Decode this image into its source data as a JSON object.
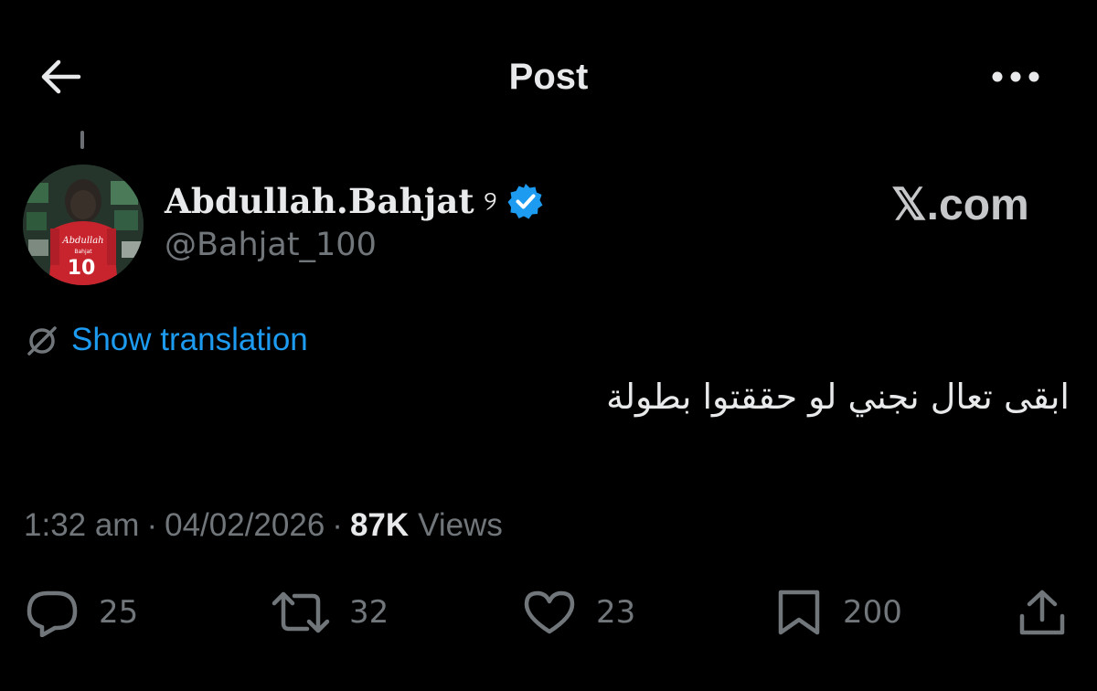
{
  "header": {
    "title": "Post",
    "back_icon": "arrow-left-icon",
    "more_icon": "more-horizontal-icon"
  },
  "author": {
    "display_name": "Abdullah.Bahjat",
    "name_emoji": "୨",
    "handle": "@Bahjat_100",
    "verified": true,
    "verified_color": "#1d9bf0",
    "avatar_jersey_name": "Abdullah",
    "avatar_jersey_sub": "Bahjat",
    "avatar_jersey_number": "10"
  },
  "watermark": {
    "text": "𝕏.com"
  },
  "translation": {
    "label": "Show translation",
    "color": "#1d9bf0"
  },
  "tweet": {
    "text": "ابقى تعال نجني لو حققتوا بطولة",
    "time": "1:32 am",
    "date": "04/02/2026",
    "separator": "·",
    "views_count": "87K",
    "views_label": "Views"
  },
  "actions": {
    "replies": "25",
    "reposts": "32",
    "likes": "23",
    "bookmarks": "200"
  },
  "colors": {
    "background": "#000000",
    "text_primary": "#e7e9ea",
    "text_secondary": "#71767b",
    "accent": "#1d9bf0"
  }
}
